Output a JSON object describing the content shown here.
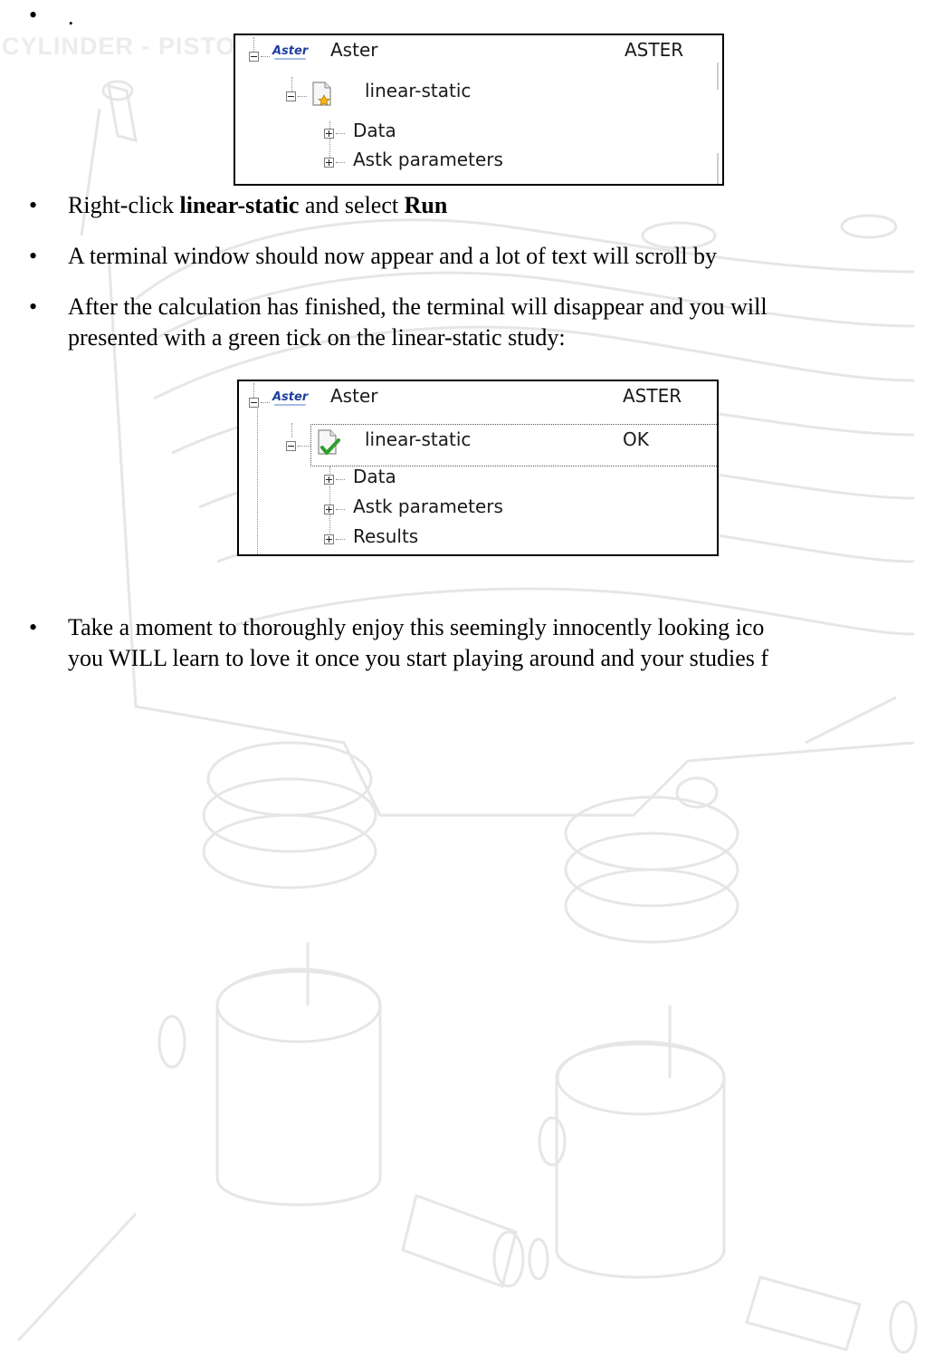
{
  "watermark": {
    "text": "CYLINDER - PISTON"
  },
  "bullets": {
    "first": ".",
    "run": {
      "pre": "Right-click ",
      "bold1": "linear-static",
      "mid": " and select ",
      "bold2": "Run"
    },
    "terminal": "A terminal window should now appear and a lot of text will scroll by",
    "after_line1": "After the calculation has finished, the terminal will disappear and you will",
    "after_line2": "presented with a green tick on the linear-static study:",
    "enjoy_line1": "Take a moment to thoroughly enjoy this seemingly innocently looking ico",
    "enjoy_line2": "you WILL learn to love it once you start playing around and your studies f"
  },
  "tree1": {
    "root_logo": "Aster",
    "root_label": "Aster",
    "root_status": "ASTER",
    "study_label": "linear-static",
    "study_status": "",
    "children": [
      "Data",
      "Astk parameters"
    ]
  },
  "tree2": {
    "root_logo": "Aster",
    "root_label": "Aster",
    "root_status": "ASTER",
    "study_label": "linear-static",
    "study_status": "OK",
    "children": [
      "Data",
      "Astk parameters",
      "Results"
    ]
  },
  "colors": {
    "study_icon_badge_pending": "#f3b51c",
    "study_icon_badge_ok": "#2f9e2f",
    "logo_blue": "#1f3f9f"
  },
  "icons": {
    "pending_study": "document-star-icon",
    "finished_study": "document-checkmark-icon",
    "expand": "tree-expand-icon",
    "collapse": "tree-collapse-icon"
  }
}
